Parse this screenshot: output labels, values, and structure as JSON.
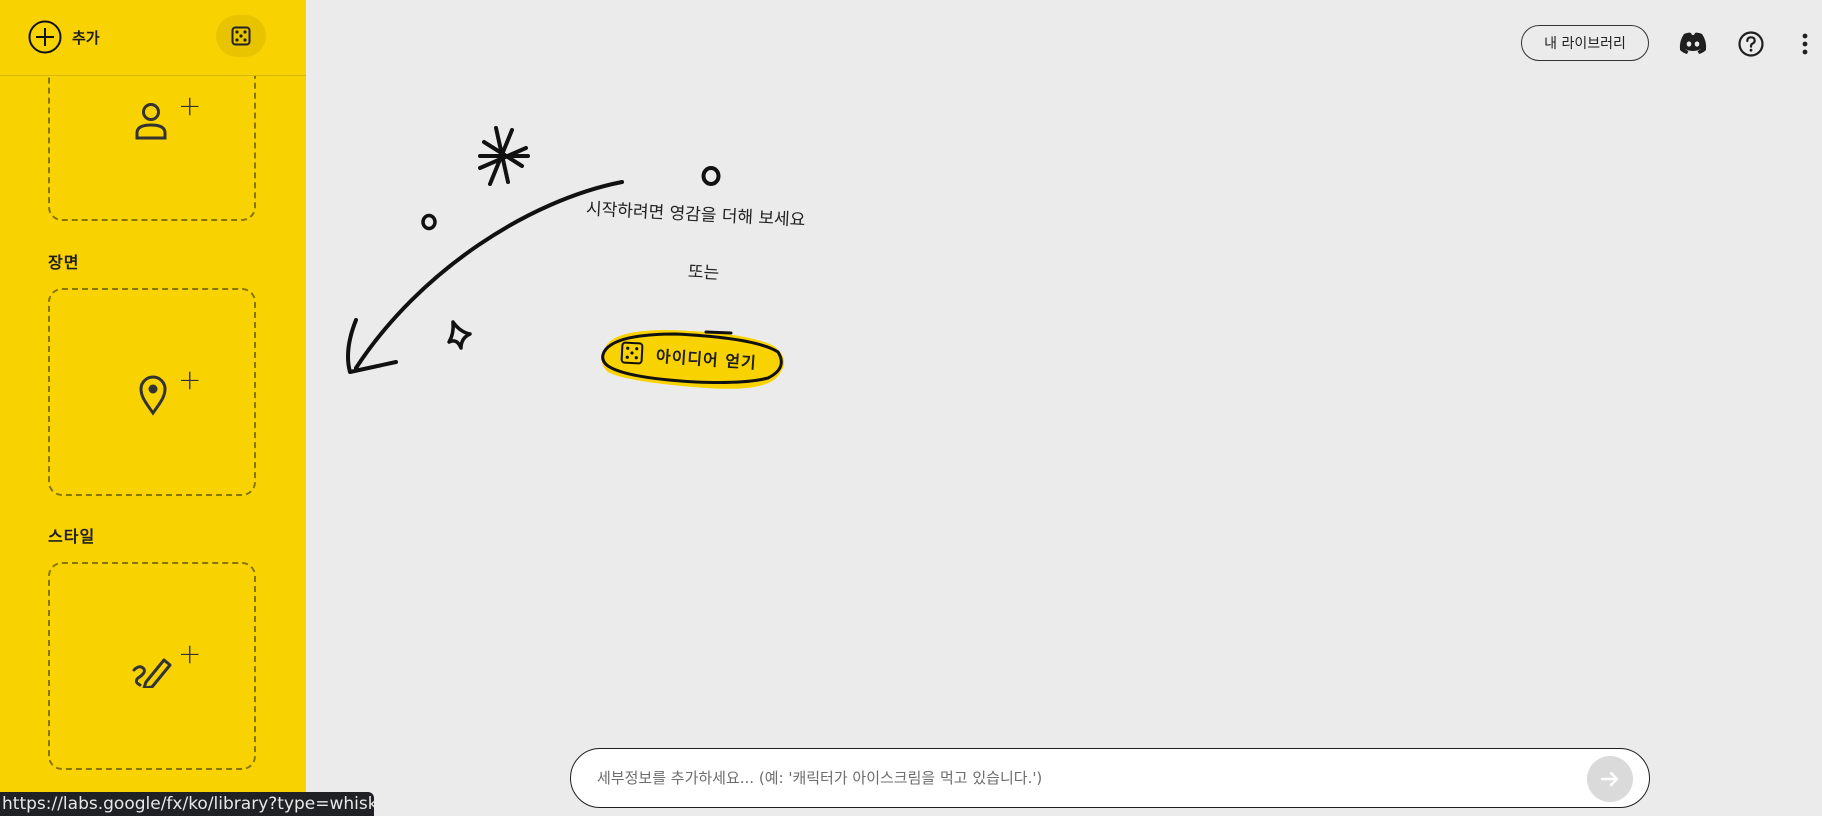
{
  "sidebar": {
    "add_label": "추가",
    "add_icon": "plus-circle-icon",
    "dice_icon": "dice-icon",
    "sections": {
      "subject_icon": "person-icon",
      "scene_title": "장면",
      "scene_icon": "location-pin-icon",
      "style_title": "스타일",
      "style_icon": "brush-icon"
    },
    "plus": "+",
    "accent_color": "#f9d301"
  },
  "topbar": {
    "library_label": "내 라이브러리",
    "discord_icon": "discord-icon",
    "help_icon": "help-circle-icon",
    "menu_icon": "more-vertical-icon"
  },
  "main": {
    "hint_line": "시작하려면 영감을 더해 보세요",
    "or_text": "또는",
    "idea_button_label": "아이디어 얻기"
  },
  "prompt": {
    "placeholder": "세부정보를 추가하세요... (예: '캐릭터가 아이스크림을 먹고 있습니다.')",
    "value": "",
    "send_icon": "arrow-right-icon"
  },
  "status_bar": {
    "url": "https://labs.google/fx/ko/library?type=whisk"
  }
}
